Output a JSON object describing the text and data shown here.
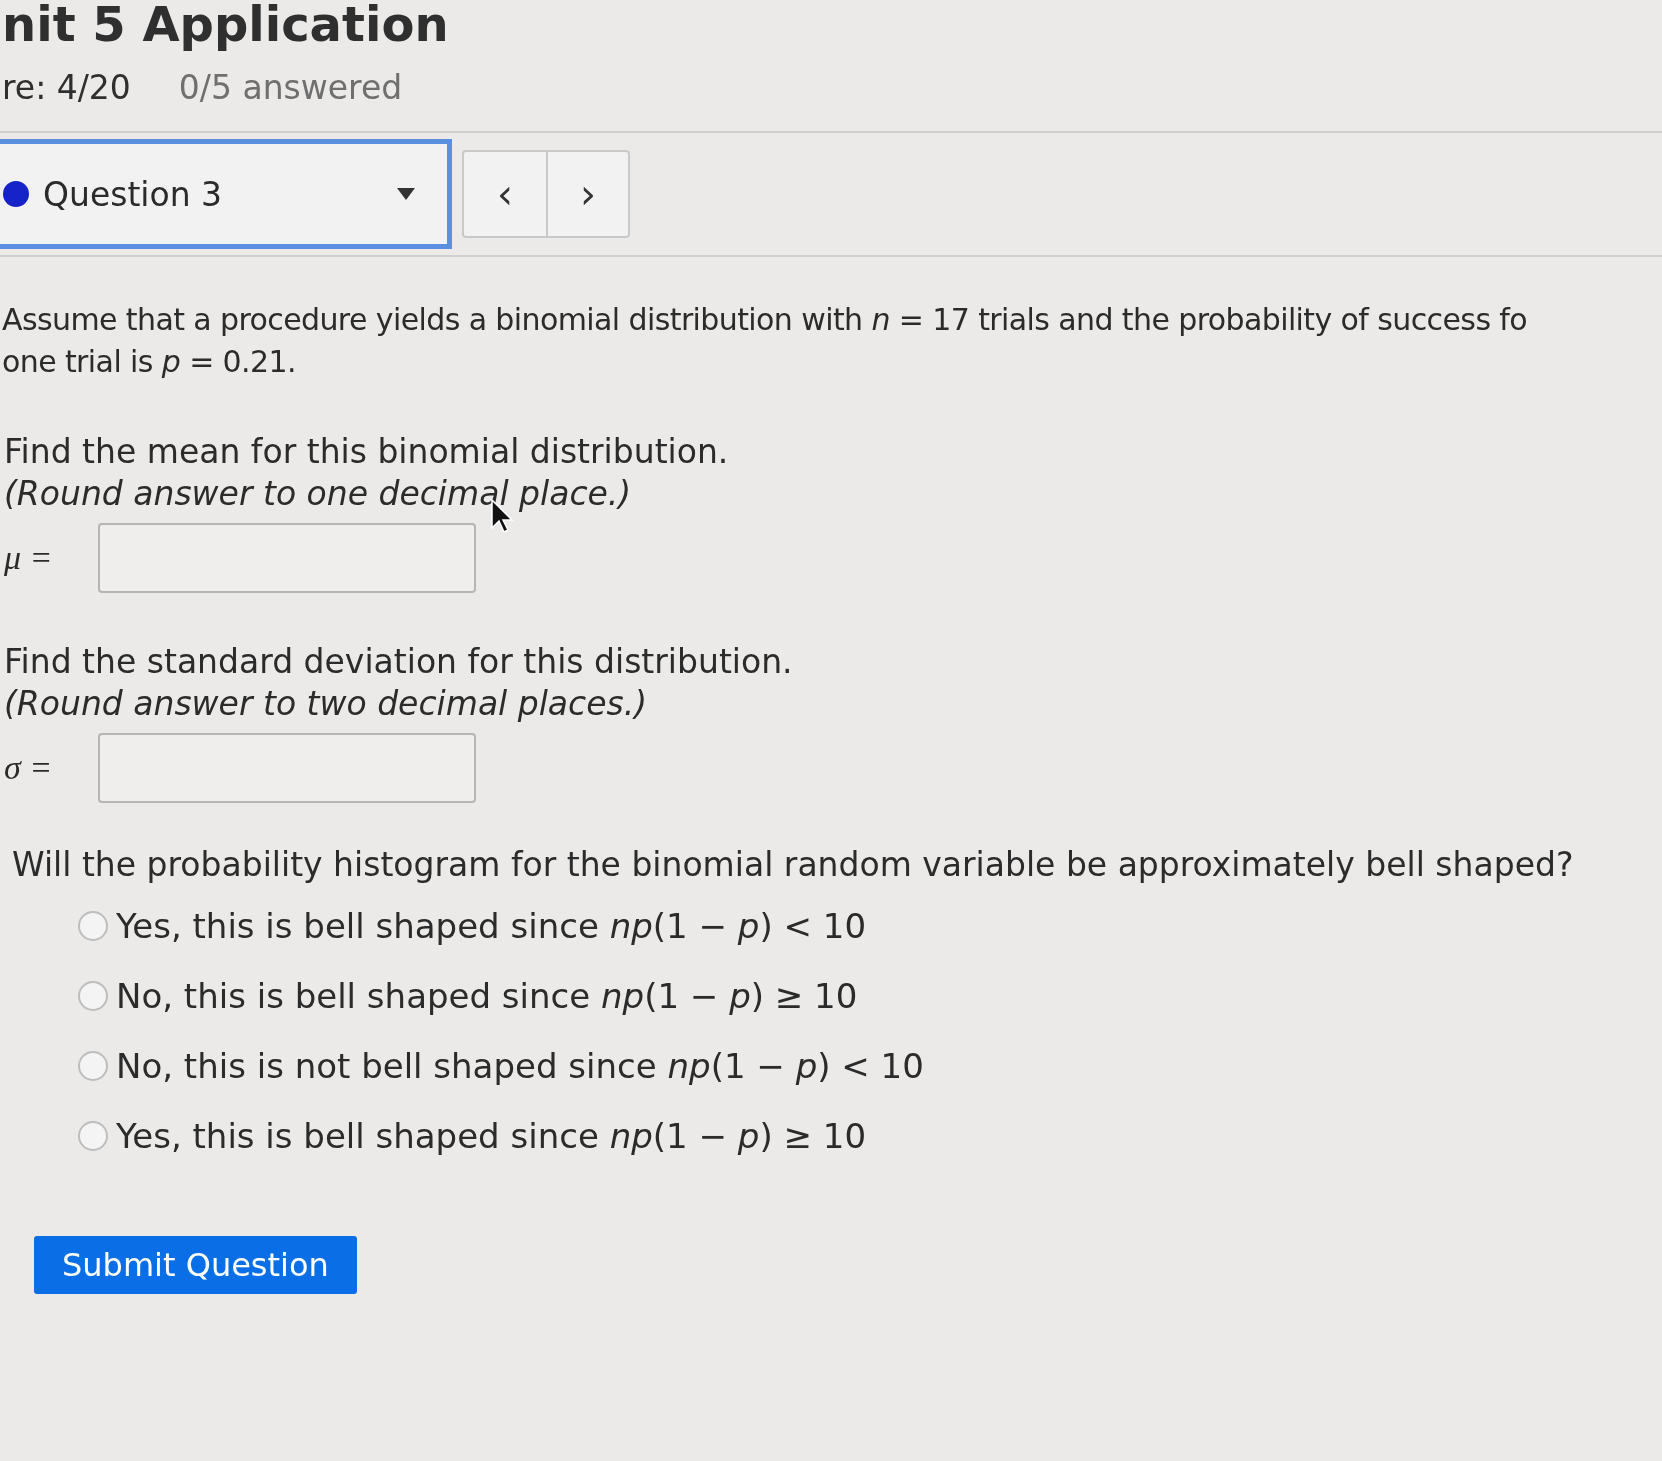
{
  "header": {
    "title": "nit 5 Application",
    "score": "re: 4/20",
    "answered": "0/5 answered"
  },
  "question_nav": {
    "selector": {
      "label": "Question 3"
    },
    "previous": "‹",
    "next": "›"
  },
  "problem": {
    "lines": [
      "Assume that a procedure yields a binomial distribution with *n* = 17 trials and the probability of success fo",
      "one trial is *p* = 0.21."
    ]
  },
  "parts": [
    {
      "prompt": "Find the mean for this binomial distribution.",
      "hint": "(Round answer to one decimal place.)",
      "symbol": "μ ="
    },
    {
      "prompt": "Find the standard deviation for this distribution.",
      "hint": "(Round answer to two decimal places.)",
      "symbol": "σ ="
    }
  ],
  "choice_question": "Will the probability histogram for the binomial random variable be approximately bell shaped?",
  "options": [
    {
      "label": "Yes, this is bell shaped since *np*(1 − *p*) < 10",
      "selected": false
    },
    {
      "label": "No, this is bell shaped since *np*(1 − *p*) ≥ 10",
      "selected": false
    },
    {
      "label": "No, this is not bell shaped since *np*(1 − *p*) < 10",
      "selected": false
    },
    {
      "label": "Yes, this is bell shaped since *np*(1 − *p*) ≥ 10",
      "selected": false
    }
  ],
  "submit": "Submit Question"
}
